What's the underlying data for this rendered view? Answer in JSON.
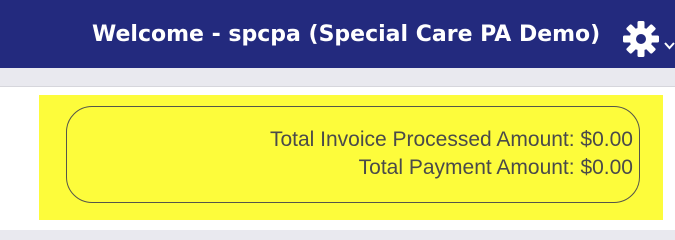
{
  "header": {
    "welcome_text": "Welcome - spcpa (Special Care PA Demo)",
    "settings_icon": "gear-icon",
    "dropdown_icon": "chevron-down-icon",
    "background_color": "#232a7e"
  },
  "summary": {
    "highlight_color": "#fdfc3b",
    "total_invoice_processed_amount": "Total Invoice Processed Amount: $0.00",
    "total_payment_amount": "Total Payment Amount: $0.00"
  }
}
